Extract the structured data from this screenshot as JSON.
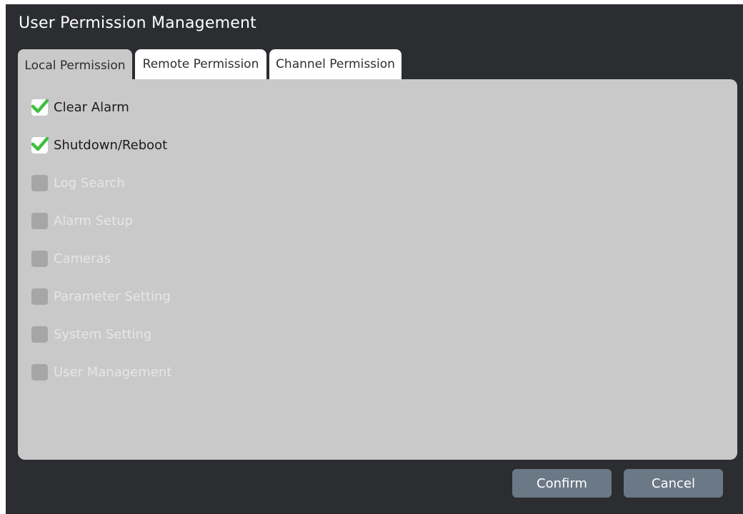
{
  "dialog": {
    "title": "User Permission Management"
  },
  "tabs": [
    {
      "label": "Local Permission",
      "active": true
    },
    {
      "label": "Remote Permission",
      "active": false
    },
    {
      "label": "Channel Permission",
      "active": false
    }
  ],
  "permissions": [
    {
      "label": "Clear Alarm",
      "checked": true,
      "enabled": true
    },
    {
      "label": "Shutdown/Reboot",
      "checked": true,
      "enabled": true
    },
    {
      "label": "Log Search",
      "checked": false,
      "enabled": false
    },
    {
      "label": "Alarm Setup",
      "checked": false,
      "enabled": false
    },
    {
      "label": "Cameras",
      "checked": false,
      "enabled": false
    },
    {
      "label": "Parameter Setting",
      "checked": false,
      "enabled": false
    },
    {
      "label": "System Setting",
      "checked": false,
      "enabled": false
    },
    {
      "label": "User Management",
      "checked": false,
      "enabled": false
    }
  ],
  "buttons": {
    "confirm_label": "Confirm",
    "cancel_label": "Cancel"
  },
  "icons": {
    "check": "checkmark-icon"
  },
  "colors": {
    "dialog_background": "#2b2d31",
    "panel_background": "#c9c9c9",
    "checkmark": "#3fbf3f",
    "button_background": "#6b7886",
    "disabled_text": "#e6e6e6"
  }
}
